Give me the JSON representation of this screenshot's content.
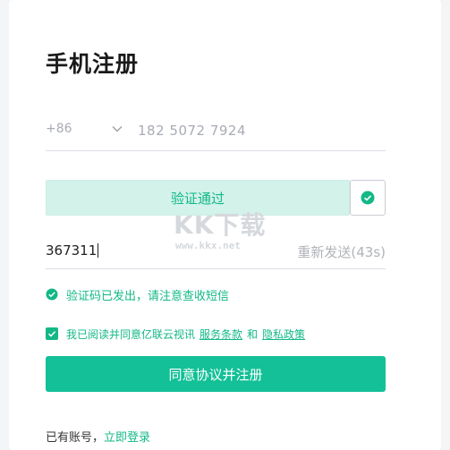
{
  "page": {
    "title": "手机注册"
  },
  "phone": {
    "country_code": "+86",
    "value": "182 5072 7924"
  },
  "captcha": {
    "status_text": "验证通过"
  },
  "watermark": {
    "big": "KK下载",
    "small": "www.kkx.net"
  },
  "sms": {
    "code_value": "367311",
    "resend_label": "重新发送(43s)",
    "sent_message": "验证码已发出，请注意查收短信"
  },
  "agreement": {
    "prefix": "我已阅读并同意亿联云视讯",
    "terms_link": "服务条款",
    "and": "和",
    "privacy_link": "隐私政策"
  },
  "actions": {
    "submit_label": "同意协议并注册",
    "has_account": "已有账号，",
    "login_link": "立即登录"
  },
  "colors": {
    "accent": "#13c097",
    "accent_text": "#12b886",
    "verify_bg": "#d2f2ea"
  }
}
